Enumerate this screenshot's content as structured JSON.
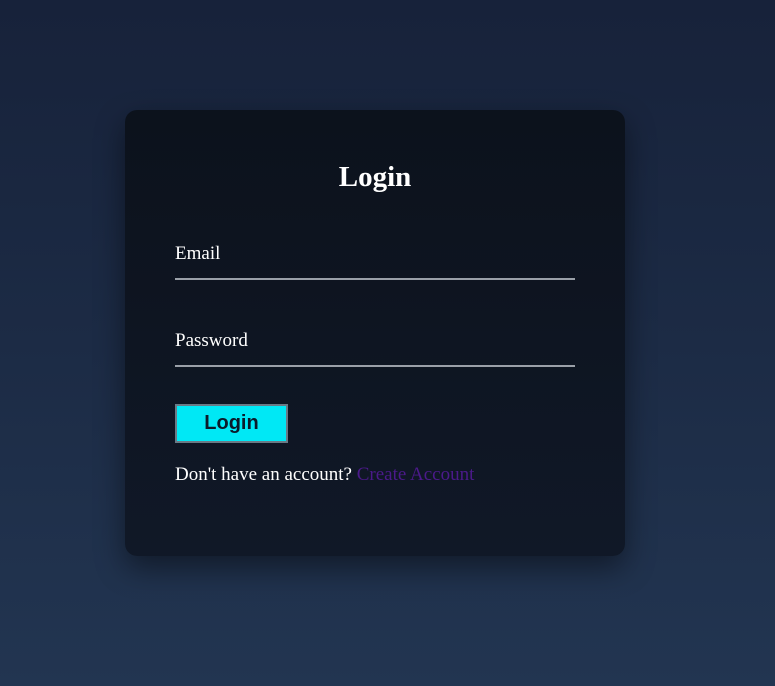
{
  "login_card": {
    "title": "Login",
    "email": {
      "label": "Email",
      "value": ""
    },
    "password": {
      "label": "Password",
      "value": ""
    },
    "submit_label": "Login",
    "signup_prompt": "Don't have an account?",
    "signup_link": "Create Account"
  },
  "colors": {
    "accent_button": "#00e8f5",
    "link": "#4b1a8a",
    "card_background": "#0e1420",
    "page_background": "#1c2b45"
  }
}
